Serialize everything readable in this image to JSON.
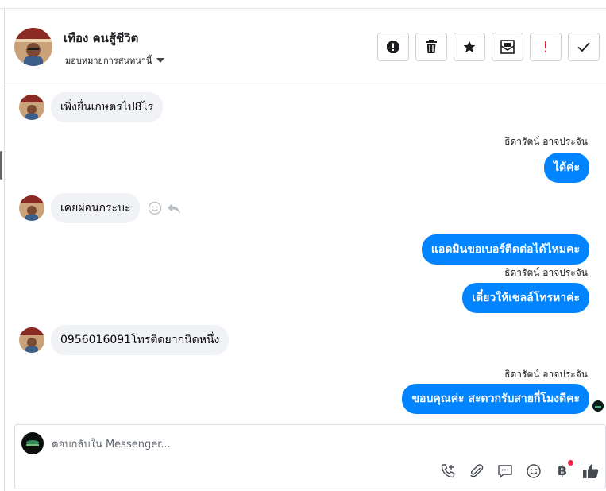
{
  "header": {
    "contact_name": "เทือง คนสู้ชีวิต",
    "assign_label": "มอบหมายการสนทนานี้",
    "actions": [
      {
        "name": "spam-icon"
      },
      {
        "name": "trash-icon"
      },
      {
        "name": "star-icon"
      },
      {
        "name": "mark-unread-icon"
      },
      {
        "name": "important-icon"
      },
      {
        "name": "done-check-icon"
      }
    ]
  },
  "messages": [
    {
      "dir": "in",
      "text": "เพิ่งยื่นเกษตรไป8ไร่"
    },
    {
      "dir": "out",
      "sender": "ธิดารัตน์ อาจประจัน",
      "text": "ได้ค่ะ"
    },
    {
      "dir": "in",
      "text": "เคยผ่อนกระบะ"
    },
    {
      "dir": "out",
      "text": "แอดมินขอเบอร์ติดต่อได้ไหมคะ"
    },
    {
      "dir": "out",
      "sender": "ธิดารัตน์ อาจประจัน",
      "text": "เดี๋ยวให้เซลล์โทรหาค่ะ"
    },
    {
      "dir": "in",
      "text": "0956016091โทรติดยากนิดหนึ่ง"
    },
    {
      "dir": "out",
      "sender": "ธิดารัตน์ อาจประจัน",
      "text": "ขอบคุณค่ะ สะดวกรับสายกี่โมงดีคะ"
    }
  ],
  "composer": {
    "placeholder": "ตอบกลับใน Messenger...",
    "baht_symbol": "฿",
    "tools": [
      "phone-add-icon",
      "attachment-icon",
      "saved-reply-icon",
      "emoji-icon",
      "baht-payment-icon",
      "like-thumb-icon"
    ]
  },
  "colors": {
    "outgoing_bubble": "#0084ff",
    "incoming_bubble": "#f0f2f5",
    "notification_dot": "#f02849"
  }
}
